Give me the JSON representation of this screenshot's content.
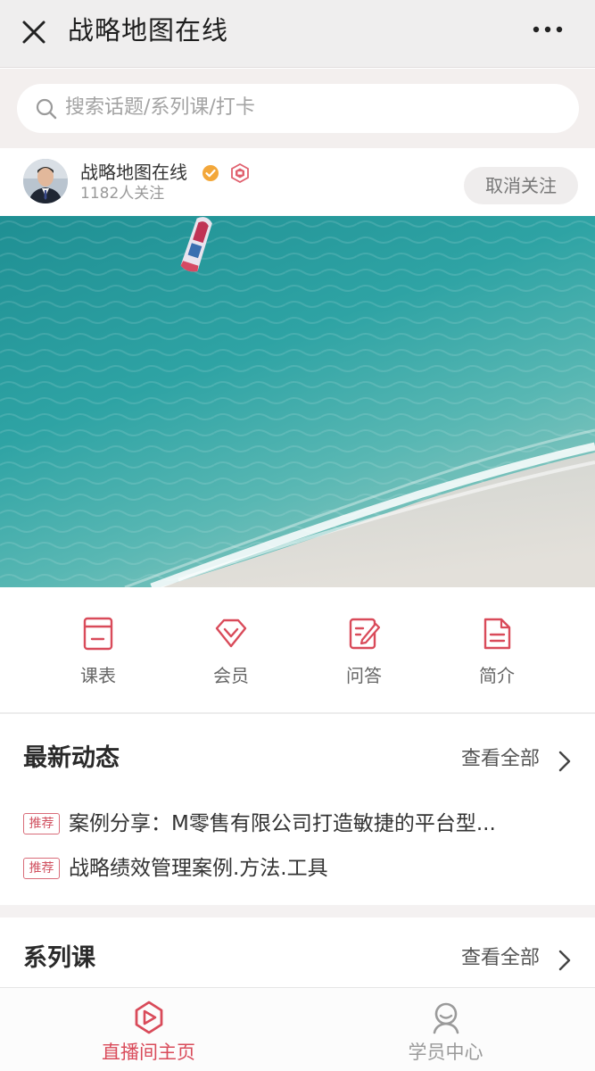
{
  "colors": {
    "accent": "#d94b5a",
    "tab_inactive": "#9a9a9a"
  },
  "navbar": {
    "title": "战略地图在线",
    "close_icon": "close-icon",
    "more_icon": "more-dots-icon"
  },
  "search": {
    "placeholder": "搜索话题/系列课/打卡",
    "icon": "search-icon"
  },
  "profile": {
    "name": "战略地图在线",
    "followers": "1182人关注",
    "unfollow_label": "取消关注",
    "verified_icon": "verified-check-icon",
    "badge_icon": "shop-badge-icon"
  },
  "banner": {
    "image": "aerial-beach-with-boat"
  },
  "quick_menu": [
    {
      "label": "课表",
      "icon": "schedule-icon"
    },
    {
      "label": "会员",
      "icon": "diamond-icon"
    },
    {
      "label": "问答",
      "icon": "edit-note-icon"
    },
    {
      "label": "简介",
      "icon": "document-icon"
    }
  ],
  "latest": {
    "title": "最新动态",
    "see_all": "查看全部",
    "items": [
      {
        "tag": "推荐",
        "text": "案例分享：M零售有限公司打造敏捷的平台型..."
      },
      {
        "tag": "推荐",
        "text": "战略绩效管理案例.方法.工具"
      }
    ]
  },
  "series": {
    "title": "系列课",
    "see_all": "查看全部"
  },
  "tabbar": [
    {
      "label": "直播间主页",
      "icon": "live-play-icon",
      "active": true
    },
    {
      "label": "学员中心",
      "icon": "user-icon",
      "active": false
    }
  ]
}
